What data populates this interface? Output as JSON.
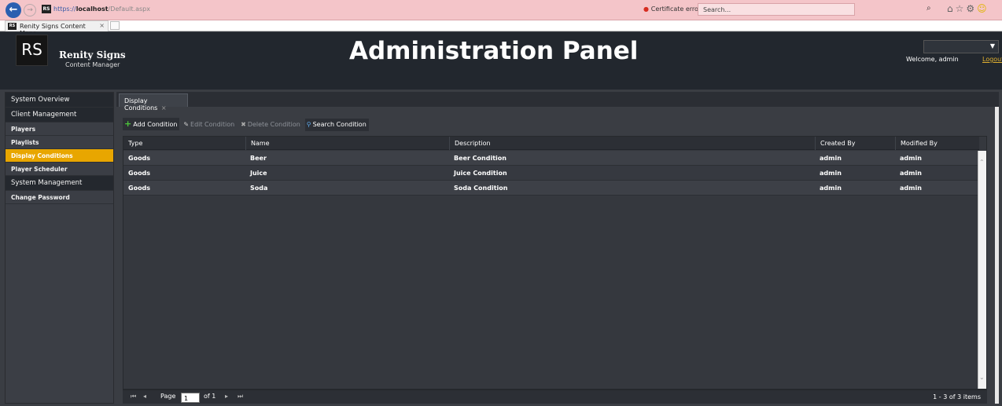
{
  "browser": {
    "back_icon": "back-arrow-icon",
    "forward_icon": "forward-arrow-icon",
    "favicon_text": "RS",
    "url_scheme": "https://",
    "url_host": "localhost",
    "url_path": "/Default.aspx",
    "cert_label": "Certificate error",
    "search_placeholder": "Search...",
    "search_icon_glyph": "⌕",
    "tools_glyphs": "⌂☆⚙",
    "smiley_glyph": "☺",
    "tab_title": "Renity Signs Content Mana",
    "tab_close": "×"
  },
  "header": {
    "logo_text": "RS",
    "brand": "Renity Signs",
    "brand_sub": "Content Manager",
    "title": "Administration Panel",
    "dropdown_arrow": "▼",
    "welcome": "Welcome, admin",
    "logout": "Logout"
  },
  "sidebar": {
    "items": [
      {
        "label": "System Overview"
      },
      {
        "label": "Client Management"
      },
      {
        "label": "Players"
      },
      {
        "label": "Playlists"
      },
      {
        "label": "Display Conditions"
      },
      {
        "label": "Player Scheduler"
      },
      {
        "label": "System Management"
      },
      {
        "label": "Change Password"
      }
    ]
  },
  "main": {
    "tab_label": "Display Conditions",
    "tab_close": "×",
    "toolbar": {
      "add": "Add Condition",
      "edit": "Edit Condition",
      "delete": "Delete Condition",
      "search": "Search Condition"
    },
    "columns": [
      "Type",
      "Name",
      "Description",
      "Created By",
      "Modified By"
    ],
    "rows": [
      [
        "Goods",
        "Beer",
        "Beer Condition",
        "admin",
        "admin"
      ],
      [
        "Goods",
        "Juice",
        "Juice Condition",
        "admin",
        "admin"
      ],
      [
        "Goods",
        "Soda",
        "Soda Condition",
        "admin",
        "admin"
      ]
    ],
    "pager": {
      "first": "⏮",
      "prev": "◂",
      "page_label": "Page",
      "page_value": "1",
      "of_label": "of 1",
      "next": "▸",
      "last": "⏭",
      "info": "1 - 3 of 3 items"
    }
  }
}
